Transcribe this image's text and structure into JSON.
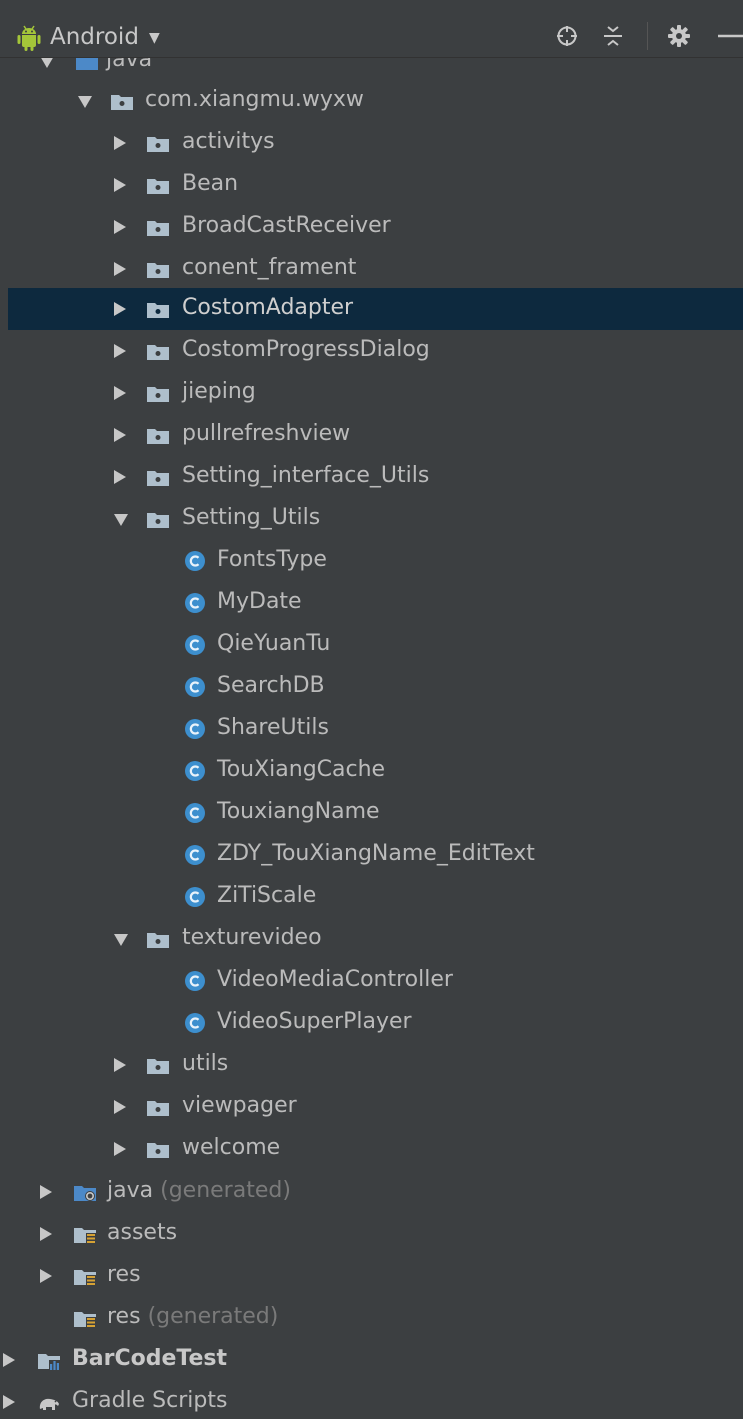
{
  "header": {
    "view_title": "Android",
    "icons": [
      "android-icon",
      "chevron-down-icon",
      "locate-icon",
      "collapse-icon",
      "gear-icon",
      "minimize-icon"
    ]
  },
  "tree": {
    "java_root": "java",
    "package": "com.xiangmu.wyxw",
    "folders_a": [
      "activitys",
      "Bean",
      "BroadCastReceiver",
      "conent_frament",
      "CostomAdapter",
      "CostomProgressDialog",
      "jieping",
      "pullrefreshview",
      "Setting_interface_Utils"
    ],
    "setting_utils": "Setting_Utils",
    "setting_utils_classes": [
      "FontsType",
      "MyDate",
      "QieYuanTu",
      "SearchDB",
      "ShareUtils",
      "TouXiangCache",
      "TouxiangName",
      "ZDY_TouXiangName_EditText",
      "ZiTiScale"
    ],
    "texturevideo": "texturevideo",
    "texturevideo_classes": [
      "VideoMediaController",
      "VideoSuperPlayer"
    ],
    "folders_b": [
      "utils",
      "viewpager",
      "welcome"
    ],
    "java_generated": {
      "name": "java",
      "suffix": "(generated)"
    },
    "assets": "assets",
    "res": "res",
    "res_generated": {
      "name": "res",
      "suffix": "(generated)"
    },
    "barcode_module": "BarCodeTest",
    "gradle_scripts": "Gradle Scripts",
    "selected": "CostomAdapter"
  },
  "colors": {
    "background": "#3c3f41",
    "selection": "#0d293e",
    "text": "#bbbbbb",
    "muted_text": "#7a7a7a",
    "class_icon": "#3d8fce",
    "folder_icon": "#aebfcc"
  }
}
